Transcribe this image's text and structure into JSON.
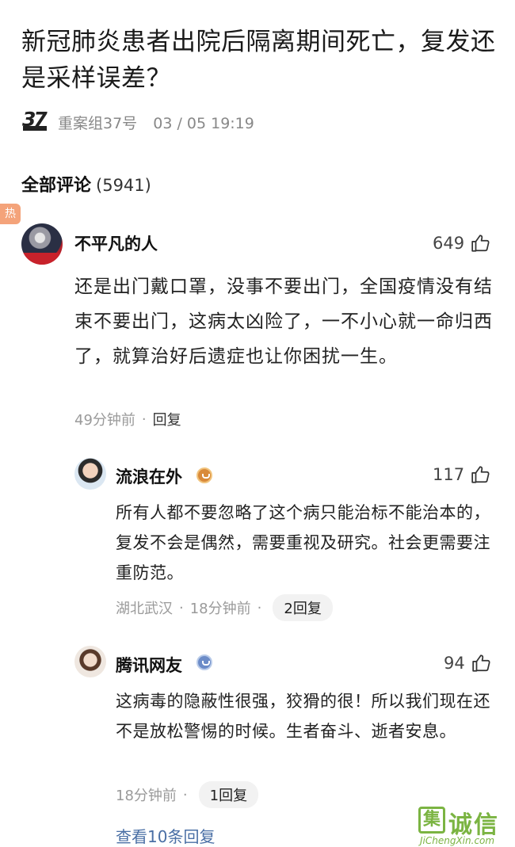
{
  "article": {
    "title": "新冠肺炎患者出院后隔离期间死亡，复发还是采样误差？",
    "author": "重案组37号",
    "time": "03 / 05 19:19",
    "author_logo": "37"
  },
  "comments_section": {
    "title": "全部评论",
    "count": "(5941)",
    "hot_tag": "热"
  },
  "comments": [
    {
      "name": "不平凡的人",
      "likes": "649",
      "text": "还是出门戴口罩，没事不要出门，全国疫情没有结束不要出门，这病太凶险了，一不小心就一命归西了，就算治好后遗症也让你困扰一生。",
      "time": "49分钟前",
      "reply_label": "回复"
    },
    {
      "name": "流浪在外",
      "badge": "gold-badge-icon",
      "likes": "117",
      "text": "所有人都不要忽略了这个病只能治标不能治本的，复发不会是偶然，需要重视及研究。社会更需要注重防范。",
      "location": "湖北武汉",
      "time": "18分钟前",
      "replies": "2回复"
    },
    {
      "name": "腾讯网友",
      "badge": "blue-badge-icon",
      "likes": "94",
      "text": "这病毒的隐蔽性很强，狡猾的很！所以我们现在还不是放松警惕的时候。生者奋斗、逝者安息。",
      "time": "18分钟前",
      "replies": "1回复"
    }
  ],
  "view_more": "查看10条回复",
  "watermark": {
    "box_char": "集",
    "cn": "诚信",
    "en": "JiChengXin.com"
  },
  "colors": {
    "link": "#4a6fa5",
    "hot_tag": "#f4a37a",
    "watermark": "#7bb442"
  }
}
